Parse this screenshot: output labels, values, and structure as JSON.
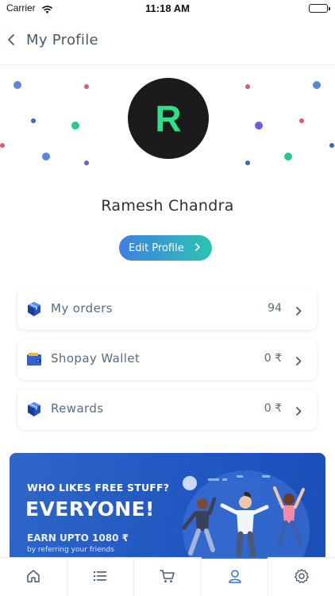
{
  "status_bar": {
    "carrier": "Carrier",
    "time": "11:18 AM"
  },
  "header": {
    "title": "My Profile",
    "back_icon": "chevron-left-icon"
  },
  "profile": {
    "avatar_initial": "R",
    "avatar_bg": "#1b1b1b",
    "avatar_letter_color": "#2ee08a",
    "name": "Ramesh Chandra",
    "edit_label": "Edit Profile"
  },
  "menu": [
    {
      "label": "My orders",
      "value": "94",
      "icon": "orders-box-icon"
    },
    {
      "label": "Shopay Wallet",
      "value": "0 ₹",
      "icon": "wallet-icon"
    },
    {
      "label": "Rewards",
      "value": "0 ₹",
      "icon": "rewards-box-icon"
    }
  ],
  "promo": {
    "line1": "WHO LIKES FREE STUFF?",
    "line2": "EVERYONE!",
    "line3": "EARN UPTO 1080 ₹",
    "line4": "by referring your friends"
  },
  "tabs": [
    {
      "name": "home",
      "icon": "home-icon",
      "active": false
    },
    {
      "name": "categories",
      "icon": "list-icon",
      "active": false
    },
    {
      "name": "cart",
      "icon": "cart-icon",
      "active": false
    },
    {
      "name": "profile",
      "icon": "user-icon",
      "active": true
    },
    {
      "name": "settings",
      "icon": "gear-icon",
      "active": false
    }
  ],
  "colors": {
    "accent_blue": "#2f6fe0",
    "gradient_start": "#3f7fe0",
    "gradient_end": "#2cc4b2",
    "promo_blue": "#2e66c9"
  }
}
